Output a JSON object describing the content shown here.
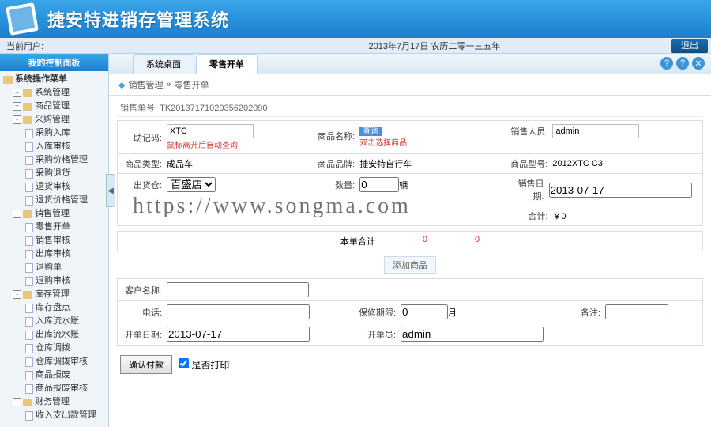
{
  "header": {
    "title": "捷安特进销存管理系统"
  },
  "statusbar": {
    "user_label": "当前用户:",
    "date": "2013年7月17日 农历二零一三五年",
    "exit": "退出"
  },
  "sidebar": {
    "header": "我的控制面板",
    "root": "系统操作菜单",
    "groups": [
      {
        "label": "系统管理",
        "children": []
      },
      {
        "label": "商品管理",
        "children": []
      },
      {
        "label": "采购管理",
        "children": [
          "采购入库",
          "入库审核",
          "采购价格管理",
          "采购退货",
          "退货审核",
          "退货价格管理"
        ]
      },
      {
        "label": "销售管理",
        "children": [
          "零售开单",
          "销售审核",
          "出库审核",
          "退购单",
          "退购审核"
        ]
      },
      {
        "label": "库存管理",
        "children": [
          "库存盘点",
          "入库流水账",
          "出库流水账",
          "仓库调拨",
          "仓库调拨审核",
          "商品报废",
          "商品报废审核"
        ]
      },
      {
        "label": "财务管理",
        "children": [
          "收入支出款管理"
        ]
      }
    ]
  },
  "tabs": {
    "t1": "系统桌面",
    "t2": "零售开单"
  },
  "breadcrumb": {
    "a": "销售管理",
    "sep": "»",
    "b": "零售开单"
  },
  "order": {
    "label": "销售单号:",
    "value": "TK20137171020356202090"
  },
  "form": {
    "mnemonic_lbl": "助记码:",
    "mnemonic_val": "XTC",
    "mnemonic_hint": "鼠标离开后自动查询",
    "product_lbl": "商品名称:",
    "product_hint_blue": "查询",
    "product_hint": "双击选择商品",
    "sales_lbl": "销售人员:",
    "sales_val": "admin",
    "type_lbl": "商品类型:",
    "type_val": "成品车",
    "brand_lbl": "商品品牌:",
    "brand_val": "捷安特自行车",
    "model_lbl": "商品型号:",
    "model_val": "2012XTC C3",
    "ware_lbl": "出货仓:",
    "ware_val": "百盛店",
    "qty_lbl": "数量:",
    "qty_val": "0",
    "qty_unit": "辆",
    "date_lbl": "销售日期:",
    "date_val": "2013-07-17",
    "total_lbl": "合计:",
    "total_val": "￥0",
    "subtotal_lbl": "本单合计",
    "subtotal_a": "0",
    "subtotal_b": "0",
    "add_btn": "添加商品",
    "cust_lbl": "客户名称:",
    "phone_lbl": "电话:",
    "warranty_lbl": "保修期限:",
    "warranty_val": "0",
    "warranty_unit": "月",
    "remark_lbl": "备注:",
    "open_lbl": "开单日期:",
    "open_val": "2013-07-17",
    "operator_lbl": "开单员:",
    "operator_val": "admin",
    "confirm": "确认付款",
    "print_lbl": "是否打印"
  },
  "watermark": "https://www.songma.com"
}
